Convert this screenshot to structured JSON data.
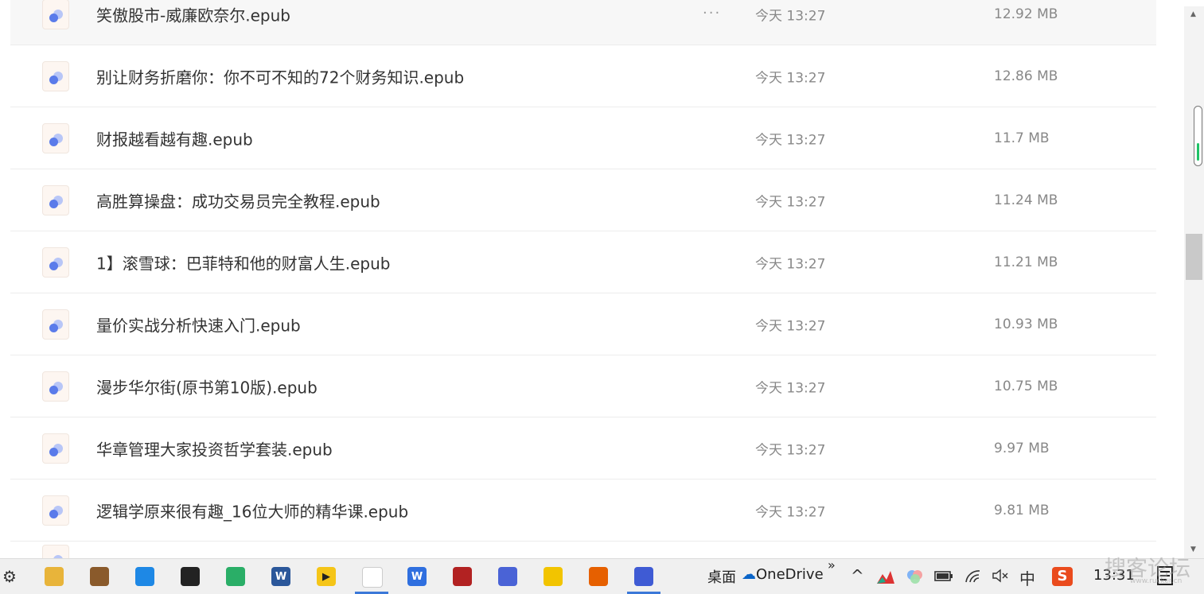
{
  "files": [
    {
      "name": "笑傲股市-威廉欧奈尔.epub",
      "date": "今天 13:27",
      "size": "12.92 MB",
      "hovered": true
    },
    {
      "name": "别让财务折磨你：你不可不知的72个财务知识.epub",
      "date": "今天 13:27",
      "size": "12.86 MB"
    },
    {
      "name": "财报越看越有趣.epub",
      "date": "今天 13:27",
      "size": "11.7 MB"
    },
    {
      "name": "高胜算操盘：成功交易员完全教程.epub",
      "date": "今天 13:27",
      "size": "11.24 MB"
    },
    {
      "name": "1】滚雪球：巴菲特和他的财富人生.epub",
      "date": "今天 13:27",
      "size": "11.21 MB"
    },
    {
      "name": "量价实战分析快速入门.epub",
      "date": "今天 13:27",
      "size": "10.93 MB"
    },
    {
      "name": "漫步华尔街(原书第10版).epub",
      "date": "今天 13:27",
      "size": "10.75 MB"
    },
    {
      "name": "华章管理大家投资哲学套装.epub",
      "date": "今天 13:27",
      "size": "9.97 MB"
    },
    {
      "name": "逻辑学原来很有趣_16位大师的精华课.epub",
      "date": "今天 13:27",
      "size": "9.81 MB"
    }
  ],
  "more_icon": "···",
  "scrollbar": {
    "up": "▲",
    "down": "▼"
  },
  "taskbar": {
    "apps": [
      {
        "name": "settings-icon",
        "glyph": "⚙",
        "color": "#f0f0f0",
        "text_color": "#333"
      },
      {
        "name": "file-explorer-icon",
        "glyph": "",
        "color": "#e8b43a"
      },
      {
        "name": "books-icon",
        "glyph": "",
        "color": "#8a5a2b"
      },
      {
        "name": "browser-blue-icon",
        "glyph": "",
        "color": "#1e88e5"
      },
      {
        "name": "qq-penguin-icon",
        "glyph": "",
        "color": "#222222"
      },
      {
        "name": "wechat-icon",
        "glyph": "",
        "color": "#2aae67"
      },
      {
        "name": "word-icon",
        "glyph": "W",
        "color": "#2b579a"
      },
      {
        "name": "video-player-icon",
        "glyph": "▶",
        "color": "#f5c518",
        "text_color": "#222"
      },
      {
        "name": "baidu-netdisk-icon",
        "glyph": "",
        "color": "#ffffff",
        "active": true
      },
      {
        "name": "wps-icon",
        "glyph": "W",
        "color": "#2f6fdf"
      },
      {
        "name": "voicemeeter-icon",
        "glyph": "",
        "color": "#b22222"
      },
      {
        "name": "circle-app-icon",
        "glyph": "",
        "color": "#4a63d6"
      },
      {
        "name": "music-icon",
        "glyph": "",
        "color": "#f2c400"
      },
      {
        "name": "firefox-icon",
        "glyph": "",
        "color": "#e66000"
      },
      {
        "name": "circle-app-2-icon",
        "glyph": "",
        "color": "#3f5bd4",
        "active": true
      }
    ],
    "desktop_label": "桌面",
    "onedrive_label": "OneDrive",
    "overflow_glyph": "»",
    "tray": {
      "chevron": "^",
      "ime_label": "中",
      "sogou_label": "S",
      "clock": "13:31"
    }
  },
  "watermark": {
    "text": "搜客论坛",
    "url": "www.rucker.cn"
  }
}
